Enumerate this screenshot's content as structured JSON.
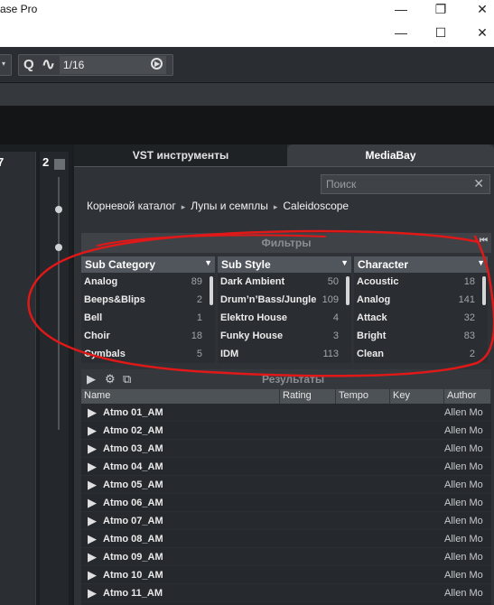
{
  "window": {
    "title": "ase Pro",
    "minimize": "—",
    "restore": "❐",
    "close": "✕",
    "maximize": "☐",
    "close2": "✕"
  },
  "toolbar": {
    "quantize_icon": "Q",
    "wave_icon": "∿",
    "grid_value": "1/16"
  },
  "left": {
    "track_num": "2",
    "track_num_left": "7"
  },
  "tabs": {
    "vst": "VST инструменты",
    "mediabay": "MediaBay"
  },
  "search": {
    "placeholder": "Поиск",
    "clear": "✕"
  },
  "breadcrumb": {
    "items": [
      "Корневой каталог",
      "Лупы и семплы",
      "Caleidoscope"
    ],
    "separator": "▸"
  },
  "filters": {
    "title": "Фильтры",
    "rewind": "⏮",
    "columns": [
      {
        "header": "Sub Category",
        "rows": [
          {
            "label": "Analog",
            "count": "89"
          },
          {
            "label": "Beeps&Blips",
            "count": "2"
          },
          {
            "label": "Bell",
            "count": "1"
          },
          {
            "label": "Choir",
            "count": "18"
          },
          {
            "label": "Cymbals",
            "count": "5"
          }
        ]
      },
      {
        "header": "Sub Style",
        "rows": [
          {
            "label": "Dark Ambient",
            "count": "50"
          },
          {
            "label": "Drum’n’Bass/Jungle",
            "count": "109"
          },
          {
            "label": "Elektro House",
            "count": "4"
          },
          {
            "label": "Funky House",
            "count": "3"
          },
          {
            "label": "IDM",
            "count": "113"
          }
        ]
      },
      {
        "header": "Character",
        "rows": [
          {
            "label": "Acoustic",
            "count": "18"
          },
          {
            "label": "Analog",
            "count": "141"
          },
          {
            "label": "Attack",
            "count": "32"
          },
          {
            "label": "Bright",
            "count": "83"
          },
          {
            "label": "Clean",
            "count": "2"
          }
        ]
      }
    ]
  },
  "results": {
    "title": "Результаты",
    "columns": [
      "Name",
      "Rating",
      "Tempo",
      "Key",
      "Author"
    ],
    "rows": [
      {
        "name": "Atmo 01_AM",
        "author": "Allen Mo"
      },
      {
        "name": "Atmo 02_AM",
        "author": "Allen Mo"
      },
      {
        "name": "Atmo 03_AM",
        "author": "Allen Mo"
      },
      {
        "name": "Atmo 04_AM",
        "author": "Allen Mo"
      },
      {
        "name": "Atmo 05_AM",
        "author": "Allen Mo"
      },
      {
        "name": "Atmo 06_AM",
        "author": "Allen Mo"
      },
      {
        "name": "Atmo 07_AM",
        "author": "Allen Mo"
      },
      {
        "name": "Atmo 08_AM",
        "author": "Allen Mo"
      },
      {
        "name": "Atmo 09_AM",
        "author": "Allen Mo"
      },
      {
        "name": "Atmo 10_AM",
        "author": "Allen Mo"
      },
      {
        "name": "Atmo 11_AM",
        "author": "Allen Mo"
      }
    ]
  },
  "colors": {
    "annotation": "#e01818",
    "panel": "#2f3337"
  }
}
